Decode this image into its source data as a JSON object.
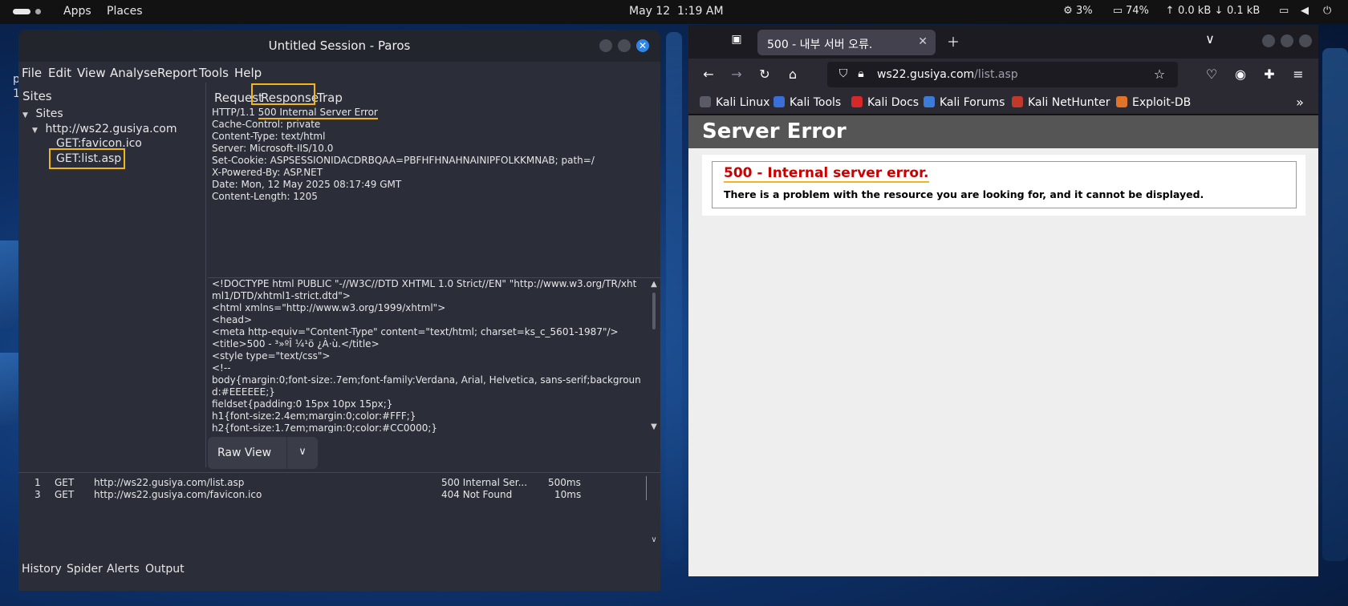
{
  "topbar": {
    "apps": "Apps",
    "places": "Places",
    "date": "May 12",
    "time": "1:19 AM",
    "cpu": "3%",
    "memory": "74%",
    "net_up": "0.0 kB",
    "net_down": "0.1 kB"
  },
  "desktop": {
    "ghost_1": "p",
    "ghost_2": "1:"
  },
  "paros": {
    "title": "Untitled Session - Paros",
    "menu": [
      "File",
      "Edit",
      "View",
      "Analyse",
      "Report",
      "Tools",
      "Help"
    ],
    "sites_header": "Sites",
    "tree": {
      "root": "Sites",
      "host": "http://ws22.gusiya.com",
      "child_1": "GET:favicon.ico",
      "child_2": "GET:list.asp"
    },
    "tabs": [
      "Request",
      "Response",
      "Trap"
    ],
    "response_headers": [
      "HTTP/1.1 500 Internal Server Error",
      "Cache-Control: private",
      "Content-Type: text/html",
      "Server: Microsoft-IIS/10.0",
      "Set-Cookie: ASPSESSIONIDACDRBQAA=PBFHFHNAHNAINIPFOLKKMNAB; path=/",
      "X-Powered-By: ASP.NET",
      "Date: Mon, 12 May 2025 08:17:49 GMT",
      "Content-Length: 1205"
    ],
    "status_line_prefix": "HTTP/1.1",
    "status_line_highlight": "500 Internal Server Error",
    "response_body": [
      "<!DOCTYPE html PUBLIC \"-//W3C//DTD XHTML 1.0 Strict//EN\" \"http://www.w3.org/TR/xhtml1/DTD/xhtml1-strict.dtd\">",
      "<html xmlns=\"http://www.w3.org/1999/xhtml\">",
      "<head>",
      "<meta http-equiv=\"Content-Type\" content=\"text/html; charset=ks_c_5601-1987\"/>",
      "<title>500 - ³»ºÎ ¼­¹ö ¿À·ù.</title>",
      "<style type=\"text/css\">",
      "<!--",
      "body{margin:0;font-size:.7em;font-family:Verdana, Arial, Helvetica, sans-serif;background:#EEEEEE;}",
      "fieldset{padding:0 15px 10px 15px;}",
      "h1{font-size:2.4em;margin:0;color:#FFF;}",
      "h2{font-size:1.7em;margin:0;color:#CC0000;}"
    ],
    "view_select": "Raw View",
    "history": [
      {
        "id": "1",
        "method": "GET",
        "url": "http://ws22.gusiya.com/list.asp",
        "status": "500 Internal Ser...",
        "time": "500ms"
      },
      {
        "id": "3",
        "method": "GET",
        "url": "http://ws22.gusiya.com/favicon.ico",
        "status": "404 Not Found",
        "time": "10ms"
      }
    ],
    "bottom_tabs": [
      "History",
      "Spider",
      "Alerts",
      "Output"
    ]
  },
  "browser": {
    "tab_title": "500 - 내부 서버 오류.",
    "url_host": "ws22.gusiya.com",
    "url_path": "/list.asp",
    "bookmarks": [
      "Kali Linux",
      "Kali Tools",
      "Kali Docs",
      "Kali Forums",
      "Kali NetHunter",
      "Exploit-DB"
    ],
    "page_heading": "Server Error",
    "error_title": "500 - Internal server error.",
    "error_message": "There is a problem with the resource you are looking for, and it cannot be displayed."
  },
  "colors": {
    "highlight": "#f3b51c",
    "error_red": "#cc0000",
    "accent_blue": "#2f86e8"
  }
}
